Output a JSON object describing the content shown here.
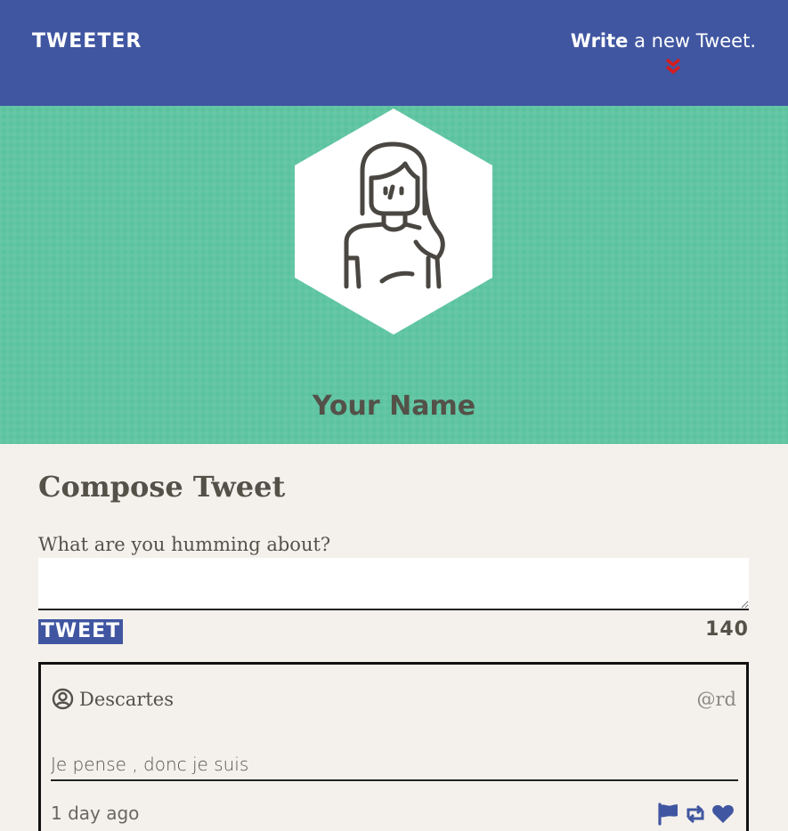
{
  "nav": {
    "brand": "TWEETER",
    "compose_strong": "Write",
    "compose_rest": " a new Tweet.",
    "chevron_icon": "double-chevron-down-icon",
    "chevron_color": "#d61c1c"
  },
  "header": {
    "avatar_icon": "girl-avatar-icon",
    "name": "Your Name"
  },
  "compose": {
    "title": "Compose Tweet",
    "label": "What are you humming about?",
    "input_value": "",
    "input_placeholder": "",
    "button_label": "TWEET",
    "counter": "140"
  },
  "tweets": [
    {
      "author": "Descartes",
      "handle": "@rd",
      "text": "Je pense , donc je suis",
      "time": "1 day ago",
      "actions": [
        "flag-icon",
        "retweet-icon",
        "heart-icon"
      ]
    }
  ],
  "colors": {
    "nav_bg": "#4056a1",
    "header_bg": "#5cc3a0",
    "page_bg": "#f4f1ec",
    "text": "#545149",
    "accent": "#4056a1"
  }
}
